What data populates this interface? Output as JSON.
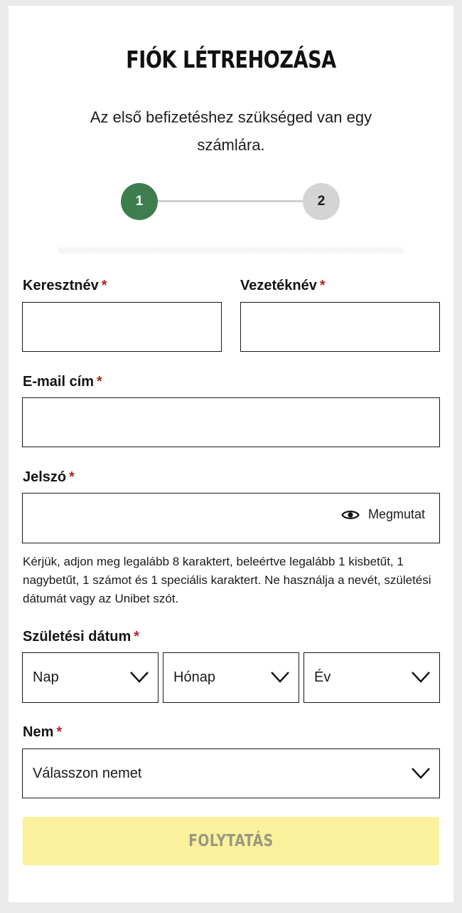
{
  "header": {
    "title": "FIÓK LÉTREHOZÁSA",
    "subtitle_line1": "Az első befizetéshez szükséged van egy",
    "subtitle_line2": "számlára."
  },
  "stepper": {
    "steps": [
      "1",
      "2"
    ],
    "active_step": 1,
    "active_color": "#3d7d4e",
    "inactive_color": "#d4d4d4"
  },
  "form": {
    "required_marker": "*",
    "first_name": {
      "label": "Keresztnév",
      "value": ""
    },
    "last_name": {
      "label": "Vezetéknév",
      "value": ""
    },
    "email": {
      "label": "E-mail cím",
      "value": ""
    },
    "password": {
      "label": "Jelszó",
      "value": "",
      "toggle_label": "Megmutat",
      "hint": "Kérjük, adjon meg legalább 8 karaktert, beleértve legalább 1 kisbetűt, 1 nagybetűt, 1 számot és 1 speciális karaktert. Ne használja a nevét, születési dátumát vagy az Unibet szót."
    },
    "birth_date": {
      "label": "Születési dátum",
      "day": "Nap",
      "month": "Hónap",
      "year": "Év"
    },
    "gender": {
      "label": "Nem",
      "placeholder": "Válasszon nemet"
    },
    "submit_label": "FOLYTATÁS",
    "submit_color": "#fbf19d",
    "required_color": "#b3261e"
  }
}
